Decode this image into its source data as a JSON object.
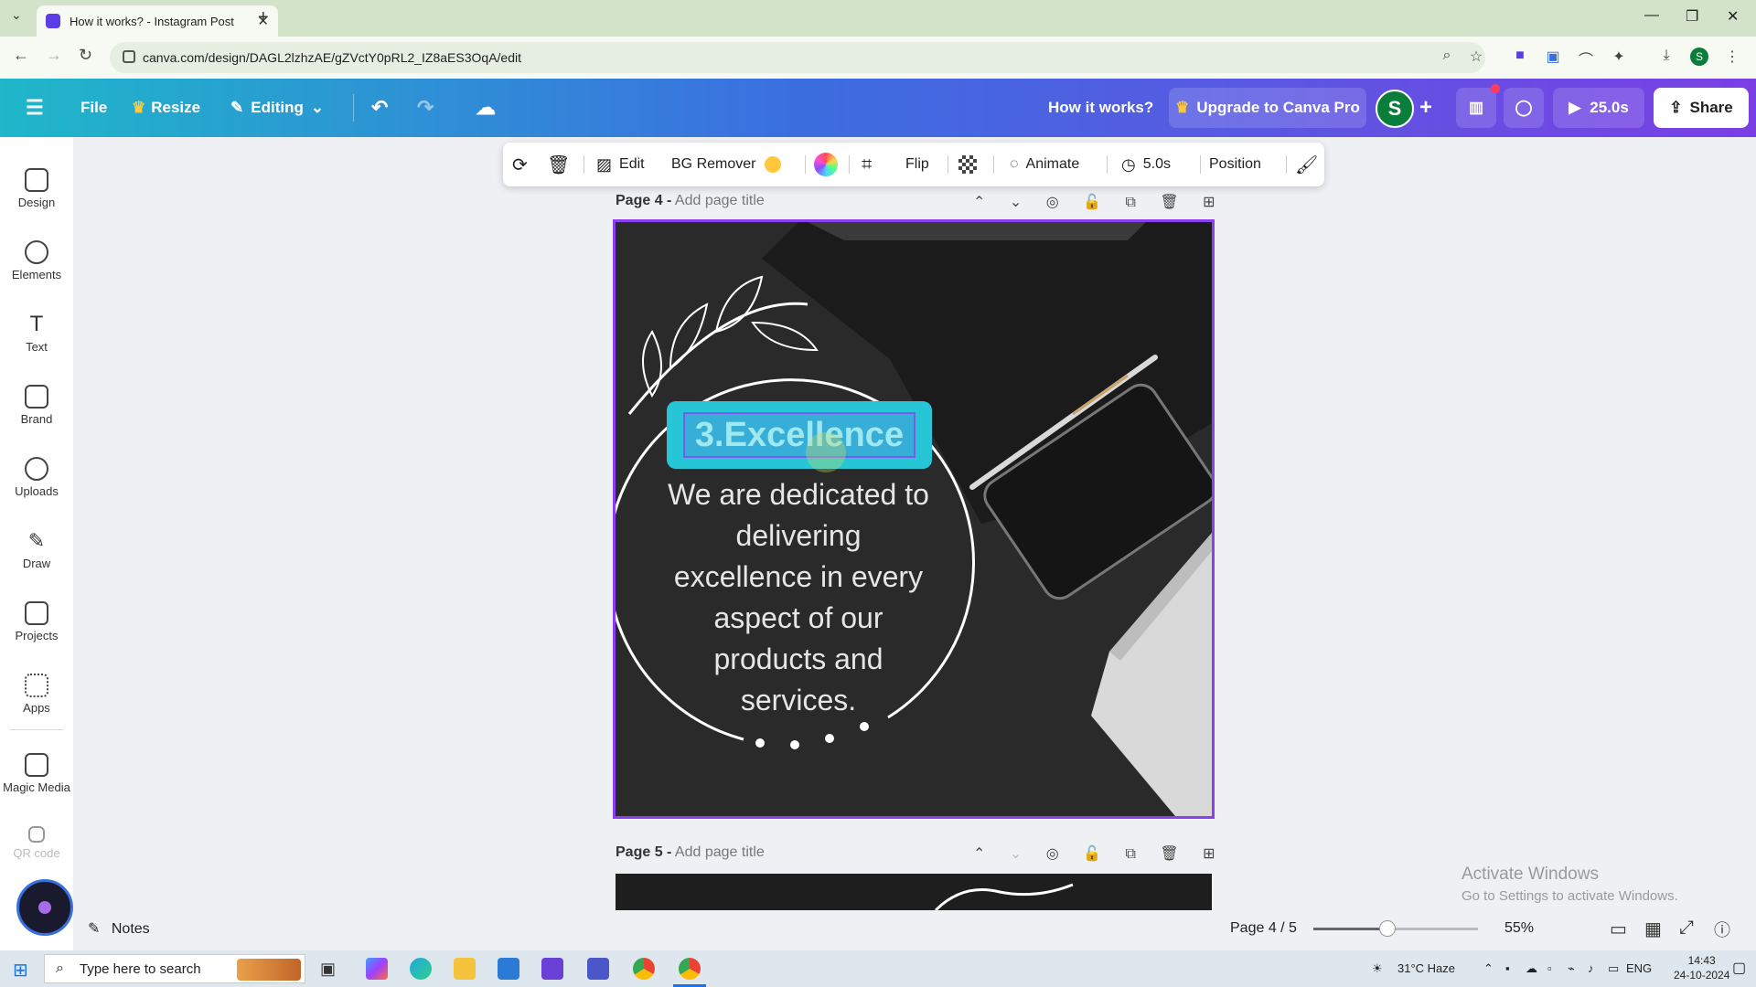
{
  "browser": {
    "tab_title": "How it works? - Instagram Post",
    "url": "canva.com/design/DAGL2lzhzAE/gZVctY0pRL2_IZ8aES3OqA/edit"
  },
  "header": {
    "file": "File",
    "resize": "Resize",
    "editing": "Editing",
    "design_title": "How it works?",
    "upgrade": "Upgrade to Canva Pro",
    "avatar_initial": "S",
    "play_time": "25.0s",
    "share": "Share"
  },
  "sidebar": {
    "items": [
      {
        "label": "Design"
      },
      {
        "label": "Elements"
      },
      {
        "label": "Text"
      },
      {
        "label": "Brand"
      },
      {
        "label": "Uploads"
      },
      {
        "label": "Draw"
      },
      {
        "label": "Projects"
      },
      {
        "label": "Apps"
      },
      {
        "label": "Magic Media"
      },
      {
        "label": "QR code"
      }
    ]
  },
  "toolbar": {
    "edit": "Edit",
    "bg_remover": "BG Remover",
    "flip": "Flip",
    "animate": "Animate",
    "duration": "5.0s",
    "position": "Position"
  },
  "pages": {
    "page4_label": "Page 4 -",
    "page4_placeholder": "Add page title",
    "page5_label": "Page 5 -",
    "page5_placeholder": "Add page title"
  },
  "design": {
    "heading": "3.Excellence",
    "body_lines": [
      "We are dedicated to",
      "delivering",
      "excellence in every",
      "aspect of our",
      "products and",
      "services."
    ]
  },
  "bottom": {
    "notes": "Notes",
    "page_indicator": "Page 4 / 5",
    "zoom": "55%",
    "zoom_fraction": 0.45,
    "watermark_title": "Activate Windows",
    "watermark_sub": "Go to Settings to activate Windows."
  },
  "taskbar": {
    "search_placeholder": "Type here to search",
    "weather": "31°C  Haze",
    "lang": "ENG",
    "time": "14:43",
    "date": "24-10-2024"
  },
  "colors": {
    "accent": "#8b3ff0",
    "heading_bg": "#26c6d6"
  }
}
